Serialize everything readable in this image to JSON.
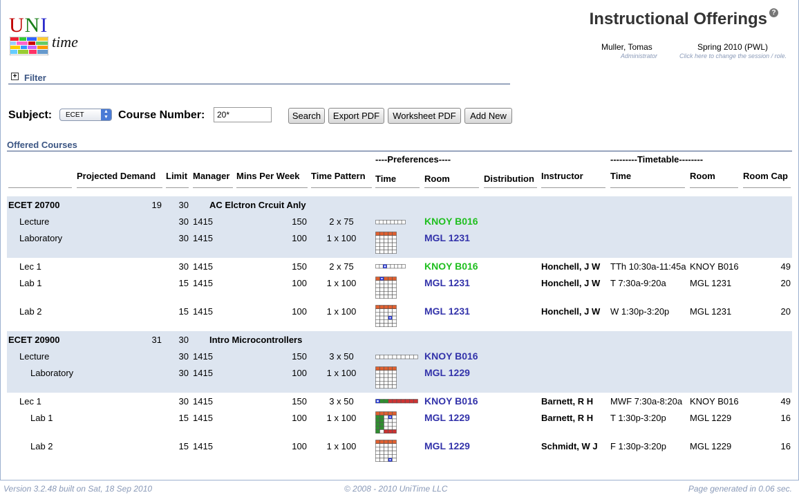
{
  "app": {
    "logo_text": "UNItime",
    "logo_letters": [
      "U",
      "N",
      "I"
    ],
    "logo_time": "time",
    "title": "Instructional Offerings",
    "help_icon": "help-icon",
    "user_name": "Muller, Tomas",
    "user_role": "Administrator",
    "session": "Spring 2010 (PWL)",
    "session_hint": "Click here to change the session / role."
  },
  "filter": {
    "toggle": "+",
    "label": "Filter",
    "subject_label": "Subject:",
    "subject_value": "ECET",
    "course_label": "Course Number:",
    "course_value": "20*"
  },
  "buttons": {
    "search": "Search",
    "export_pdf": "Export PDF",
    "worksheet_pdf": "Worksheet PDF",
    "add_new": "Add New"
  },
  "section": {
    "title": "Offered Courses"
  },
  "headers": {
    "preferences": "----Preferences----",
    "timetable": "---------Timetable--------",
    "projected_demand": "Projected Demand",
    "limit": "Limit",
    "manager": "Manager",
    "mins_per_week": "Mins Per Week",
    "time_pattern": "Time Pattern",
    "pref_time": "Time",
    "pref_room": "Room",
    "distribution": "Distribution",
    "instructor": "Instructor",
    "tt_time": "Time",
    "tt_room": "Room",
    "room_cap": "Room Cap"
  },
  "courses": [
    {
      "name": "ECET 20700",
      "demand": "19",
      "limit": "30",
      "title": "AC Elctron Crcuit Anly",
      "config": [
        {
          "name": "Lecture",
          "limit": "30",
          "manager": "1415",
          "mins": "150",
          "pattern": "2 x 75",
          "room": "KNOY B016",
          "room_color": "green"
        },
        {
          "name": "Laboratory",
          "limit": "30",
          "manager": "1415",
          "mins": "100",
          "pattern": "1 x 100",
          "room": "MGL 1231",
          "room_color": "blue"
        }
      ],
      "classes": [
        {
          "name": "Lec 1",
          "limit": "30",
          "manager": "1415",
          "mins": "150",
          "pattern": "2 x 75",
          "room": "KNOY B016",
          "room_color": "green",
          "instructor": "Honchell, J W",
          "time": "TTh 10:30a-11:45a",
          "tt_room": "KNOY B016",
          "cap": "49"
        },
        {
          "name": "Lab 1",
          "limit": "15",
          "manager": "1415",
          "mins": "100",
          "pattern": "1 x 100",
          "room": "MGL 1231",
          "room_color": "blue",
          "instructor": "Honchell, J W",
          "time": "T 7:30a-9:20a",
          "tt_room": "MGL 1231",
          "cap": "20"
        },
        {
          "name": "Lab 2",
          "limit": "15",
          "manager": "1415",
          "mins": "100",
          "pattern": "1 x 100",
          "room": "MGL 1231",
          "room_color": "blue",
          "instructor": "Honchell, J W",
          "time": "W 1:30p-3:20p",
          "tt_room": "MGL 1231",
          "cap": "20"
        }
      ]
    },
    {
      "name": "ECET 20900",
      "demand": "31",
      "limit": "30",
      "title": "Intro Microcontrollers",
      "config": [
        {
          "name": "Lecture",
          "limit": "30",
          "manager": "1415",
          "mins": "150",
          "pattern": "3 x 50",
          "room": "KNOY B016",
          "room_color": "blue"
        },
        {
          "name": "Laboratory",
          "limit": "30",
          "manager": "1415",
          "mins": "100",
          "pattern": "1 x 100",
          "room": "MGL 1229",
          "room_color": "blue"
        }
      ],
      "classes": [
        {
          "name": "Lec 1",
          "limit": "30",
          "manager": "1415",
          "mins": "150",
          "pattern": "3 x 50",
          "room": "KNOY B016",
          "room_color": "blue",
          "instructor": "Barnett, R H",
          "time": "MWF 7:30a-8:20a",
          "tt_room": "KNOY B016",
          "cap": "49"
        },
        {
          "name": "Lab 1",
          "limit": "15",
          "manager": "1415",
          "mins": "100",
          "pattern": "1 x 100",
          "room": "MGL 1229",
          "room_color": "blue",
          "instructor": "Barnett, R H",
          "time": "T 1:30p-3:20p",
          "tt_room": "MGL 1229",
          "cap": "16"
        },
        {
          "name": "Lab 2",
          "limit": "15",
          "manager": "1415",
          "mins": "100",
          "pattern": "1 x 100",
          "room": "MGL 1229",
          "room_color": "blue",
          "instructor": "Schmidt, W J",
          "time": "F 1:30p-3:20p",
          "tt_room": "MGL 1229",
          "cap": "16"
        }
      ]
    }
  ],
  "footer": {
    "version": "Version 3.2.48 built on Sat, 18 Sep 2010",
    "copyright": "© 2008 - 2010 UniTime LLC",
    "generated": "Page generated in 0.06 sec."
  },
  "colors": {
    "accent": "#3b5583",
    "band": "#dde5f0",
    "room_green": "#1fbf1f",
    "room_blue": "#3333aa",
    "pattern_orange": "#e06030",
    "pattern_red": "#cc3333",
    "pattern_green": "#2f8f2f",
    "pattern_selected": "#2233dd"
  }
}
